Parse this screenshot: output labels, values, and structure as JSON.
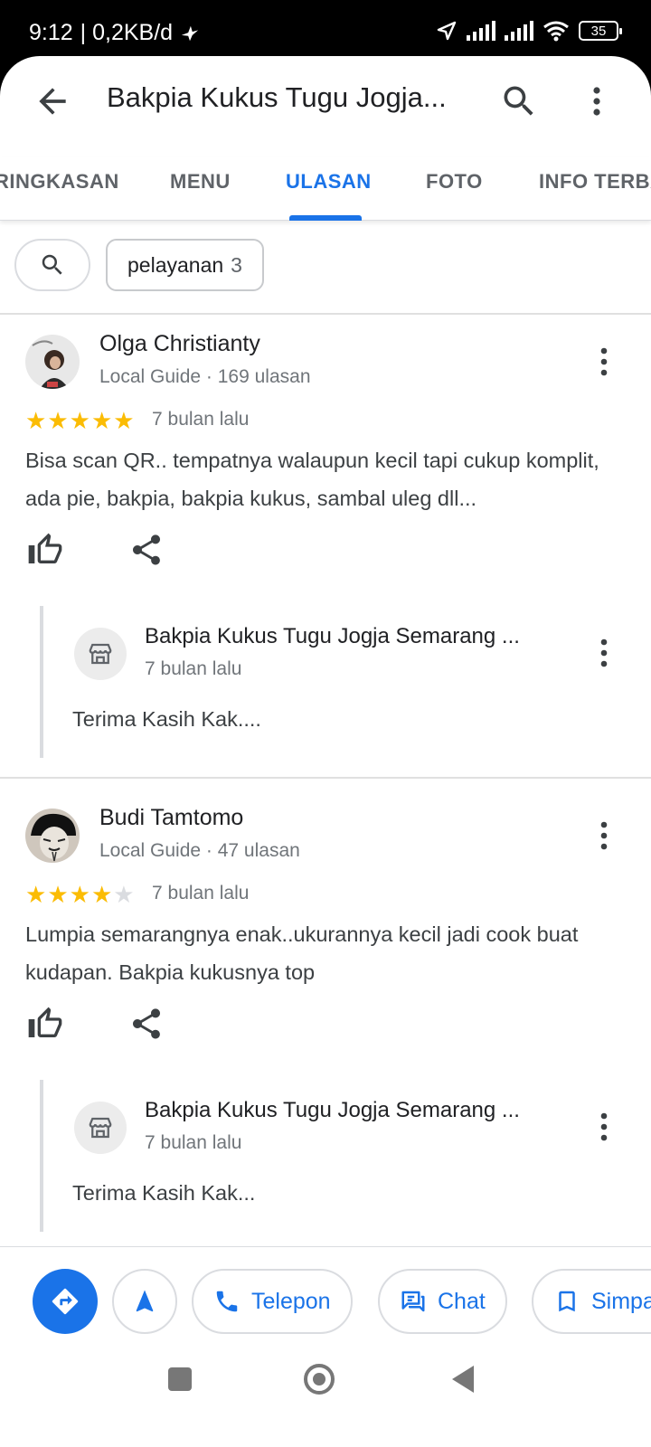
{
  "status": {
    "time": "9:12",
    "net_speed": "| 0,2KB/d",
    "battery": "35"
  },
  "header": {
    "title": "Bakpia Kukus Tugu Jogja..."
  },
  "tabs": [
    "RINGKASAN",
    "MENU",
    "ULASAN",
    "FOTO",
    "INFO TERBARU"
  ],
  "active_tab": "ULASAN",
  "filter": {
    "chip_label": "pelayanan",
    "chip_count": "3"
  },
  "reviews": [
    {
      "name": "Olga Christianty",
      "meta": "Local Guide · 169 ulasan",
      "rating": 5,
      "date": "7 bulan lalu",
      "text": "Bisa scan QR.. tempatnya walaupun kecil tapi cukup komplit, ada pie, bakpia, bakpia kukus, sambal uleg dll...",
      "reply": {
        "owner": "Bakpia Kukus Tugu Jogja Semarang ...",
        "date": "7 bulan lalu",
        "text": "Terima Kasih Kak...."
      }
    },
    {
      "name": "Budi Tamtomo",
      "meta": "Local Guide · 47 ulasan",
      "rating": 4,
      "date": "7 bulan lalu",
      "text": "Lumpia semarangnya enak..ukurannya kecil jadi cook buat kudapan. Bakpia kukusnya top",
      "reply": {
        "owner": "Bakpia Kukus Tugu Jogja Semarang ...",
        "date": "7 bulan lalu",
        "text": "Terima Kasih Kak..."
      }
    }
  ],
  "actions": {
    "call": "Telepon",
    "chat": "Chat",
    "save": "Simpan"
  },
  "colors": {
    "accent": "#1a73e8",
    "star": "#fbbc04"
  }
}
